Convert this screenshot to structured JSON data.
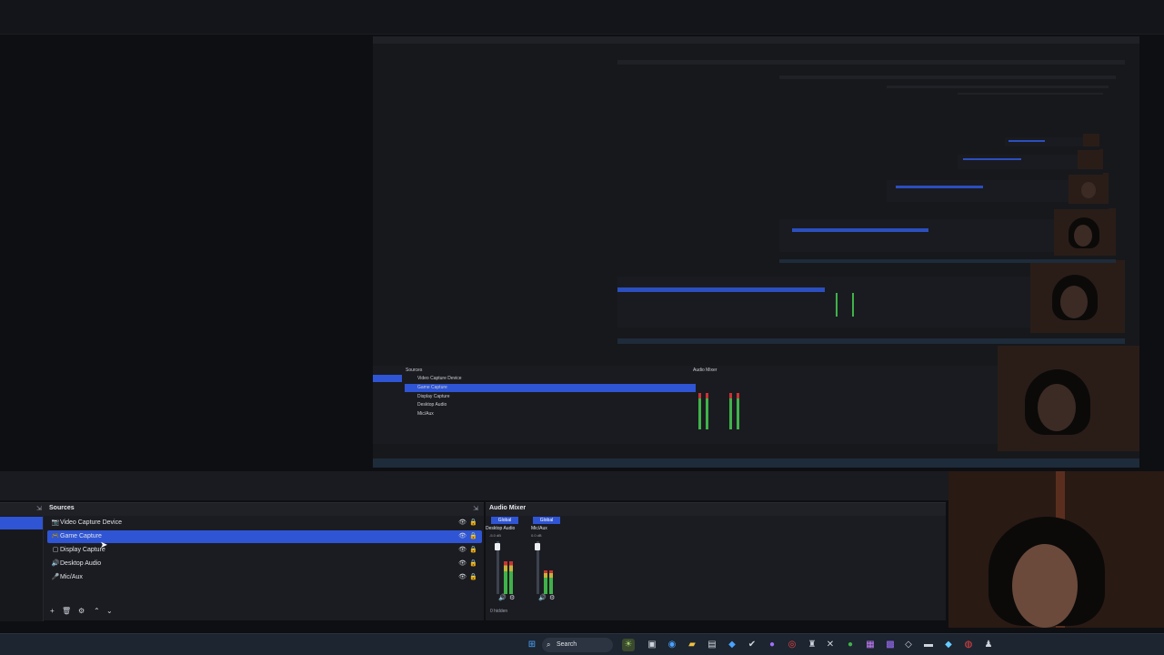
{
  "sources": {
    "title": "Sources",
    "items": [
      {
        "icon": "📷",
        "label": "Video Capture Device",
        "selected": false
      },
      {
        "icon": "🎮",
        "label": "Game Capture",
        "selected": true
      },
      {
        "icon": "▢",
        "label": "Display Capture",
        "selected": false
      },
      {
        "icon": "🔊",
        "label": "Desktop Audio",
        "selected": false
      },
      {
        "icon": "🎤",
        "label": "Mic/Aux",
        "selected": false
      }
    ],
    "toolbar": [
      "+",
      "🗑",
      "⚙",
      "⌃",
      "⌄"
    ]
  },
  "mixer": {
    "title": "Audio Mixer",
    "channels": [
      {
        "badge": "Global",
        "name": "Desktop Audio",
        "db": "-5.0 dB",
        "level": 0.62
      },
      {
        "badge": "Global",
        "name": "Mic/Aux",
        "db": "0.0 dB",
        "level": 0.45
      }
    ],
    "hidden_label": "0 hidden"
  },
  "mirror_sources": [
    "Video Capture Device",
    "Game Capture",
    "Display Capture",
    "Desktop Audio",
    "Mic/Aux"
  ],
  "taskbar": {
    "search_label": "Search",
    "icons": [
      "windows-start-icon",
      "task-view-icon",
      "folder-icon",
      "edge-icon",
      "vscode-icon",
      "obs-icon",
      "chrome-icon",
      "spotify-icon",
      "steam-icon",
      "terminal-icon"
    ]
  },
  "colors": {
    "accent": "#2f55d4",
    "panel": "#1b1c21",
    "background": "#0e0f12"
  }
}
